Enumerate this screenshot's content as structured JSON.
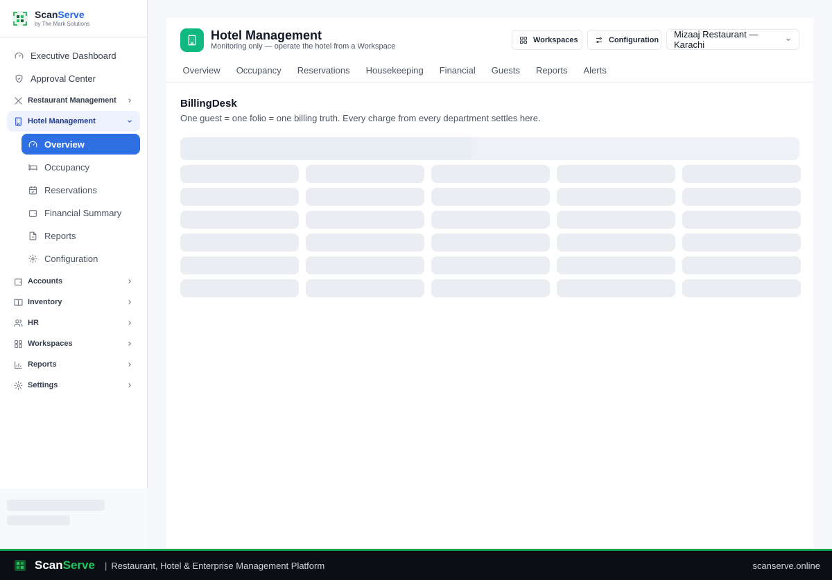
{
  "brand": {
    "name_part1": "Scan",
    "name_part2": "Serve",
    "subtitle": "by The Mark Solutions"
  },
  "sidebar": {
    "top_items": [
      {
        "label": "Executive Dashboard",
        "icon": "gauge-icon"
      },
      {
        "label": "Approval Center",
        "icon": "shield-check-icon"
      }
    ],
    "groups": [
      {
        "label": "Restaurant Management",
        "icon": "utensils-icon",
        "expanded": false
      },
      {
        "label": "Hotel Management",
        "icon": "building-icon",
        "expanded": true
      },
      {
        "label": "Accounts",
        "icon": "wallet-icon",
        "expanded": false
      },
      {
        "label": "Inventory",
        "icon": "book-icon",
        "expanded": false
      },
      {
        "label": "HR",
        "icon": "users-icon",
        "expanded": false
      },
      {
        "label": "Workspaces",
        "icon": "grid-icon",
        "expanded": false
      },
      {
        "label": "Reports",
        "icon": "bar-chart-icon",
        "expanded": false
      },
      {
        "label": "Settings",
        "icon": "gear-icon",
        "expanded": false
      }
    ],
    "hotel_sub_items": [
      {
        "label": "Overview",
        "icon": "gauge-icon",
        "active": true
      },
      {
        "label": "Occupancy",
        "icon": "bed-icon",
        "active": false
      },
      {
        "label": "Reservations",
        "icon": "calendar-check-icon",
        "active": false
      },
      {
        "label": "Financial Summary",
        "icon": "wallet-icon",
        "active": false
      },
      {
        "label": "Reports",
        "icon": "file-icon",
        "active": false
      },
      {
        "label": "Configuration",
        "icon": "gear-icon",
        "active": false
      }
    ]
  },
  "header": {
    "title": "Hotel Management",
    "subtitle": "Monitoring only — operate the hotel from a Workspace",
    "workspaces_button": "Workspaces",
    "configuration_button": "Configuration",
    "location_select": "Mizaaj Restaurant — Karachi"
  },
  "tabs": [
    "Overview",
    "Occupancy",
    "Reservations",
    "Housekeeping",
    "Financial",
    "Guests",
    "Reports",
    "Alerts"
  ],
  "section": {
    "title": "BillingDesk",
    "description": "One guest = one folio = one billing truth. Every charge from every department settles here."
  },
  "footer": {
    "brand_part1": "Scan",
    "brand_part2": "Serve",
    "separator": "|",
    "tagline": "Restaurant, Hotel & Enterprise Management Platform",
    "website": "scanserve.online"
  },
  "colors": {
    "accent": "#2f6fe4",
    "brand_green": "#10b981",
    "footer_bg": "#0b0f14"
  }
}
